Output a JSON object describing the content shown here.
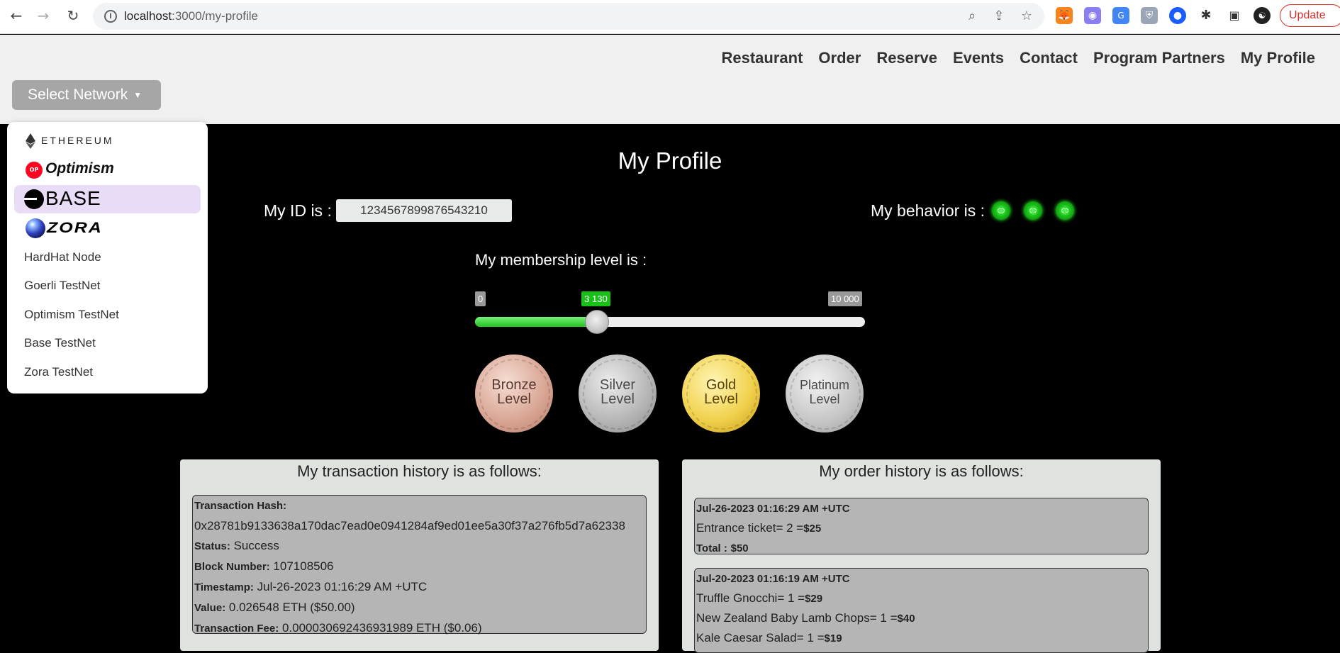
{
  "browser": {
    "url_host": "localhost",
    "url_path": ":3000/my-profile",
    "update_label": "Update"
  },
  "nav": {
    "items": [
      "Restaurant",
      "Order",
      "Reserve",
      "Events",
      "Contact",
      "Program Partners",
      "My Profile"
    ]
  },
  "network_select": {
    "label": "Select Network",
    "options": {
      "ethereum": "ETHEREUM",
      "optimism": "Optimism",
      "base": "BASE",
      "zora": "ZORA",
      "hardhat": "HardHat Node",
      "goerli": "Goerli TestNet",
      "optimism_test": "Optimism TestNet",
      "base_test": "Base TestNet",
      "zora_test": "Zora TestNet"
    },
    "highlighted": "BASE"
  },
  "profile": {
    "title": "My Profile",
    "id_label": "My ID is :",
    "id_value": "1234567899876543210",
    "behavior_label": "My behavior is :",
    "behavior_indicators": 3,
    "membership_label": "My membership level is :",
    "slider": {
      "min": 0,
      "max": 10000,
      "value": 3130,
      "min_label": "0",
      "max_label": "10 000",
      "value_label": "3 130"
    },
    "medals": {
      "bronze": [
        "Bronze",
        "Level"
      ],
      "silver": [
        "Silver",
        "Level"
      ],
      "gold": [
        "Gold",
        "Level"
      ],
      "platinum": [
        "Platinum",
        "Level"
      ]
    }
  },
  "transactions": {
    "title": "My transaction history is as follows:",
    "items": [
      {
        "hash_label": "Transaction Hash:",
        "hash": "0x28781b9133638a170dac7ead0e0941284af9ed01ee5a30f37a276fb5d7a62338",
        "status_label": "Status:",
        "status": "Success",
        "block_label": "Block Number:",
        "block": "107108506",
        "timestamp_label": "Timestamp:",
        "timestamp": "Jul-26-2023 01:16:29 AM +UTC",
        "value_label": "Value:",
        "value": "0.026548 ETH ($50.00)",
        "fee_label": "Transaction Fee:",
        "fee": "0.000030692436931989 ETH ($0.06)"
      }
    ]
  },
  "orders": {
    "title": "My order history is as follows:",
    "items": [
      {
        "date": "Jul-26-2023 01:16:29 AM +UTC",
        "lines": [
          {
            "text": "Entrance ticket= 2 =",
            "price": "$25"
          }
        ],
        "total_label": "Total :",
        "total": "$50"
      },
      {
        "date": "Jul-20-2023 01:16:19 AM +UTC",
        "lines": [
          {
            "text": "Truffle Gnocchi= 1 =",
            "price": "$29"
          },
          {
            "text": "New Zealand Baby Lamb Chops= 1 =",
            "price": "$40"
          },
          {
            "text": "Kale Caesar Salad= 1 =",
            "price": "$19"
          }
        ]
      }
    ]
  },
  "colors": {
    "accent_green": "#18c018",
    "base_highlight": "#e8dcf7",
    "optimism_red": "#ff0420",
    "update_red": "#d93025"
  }
}
